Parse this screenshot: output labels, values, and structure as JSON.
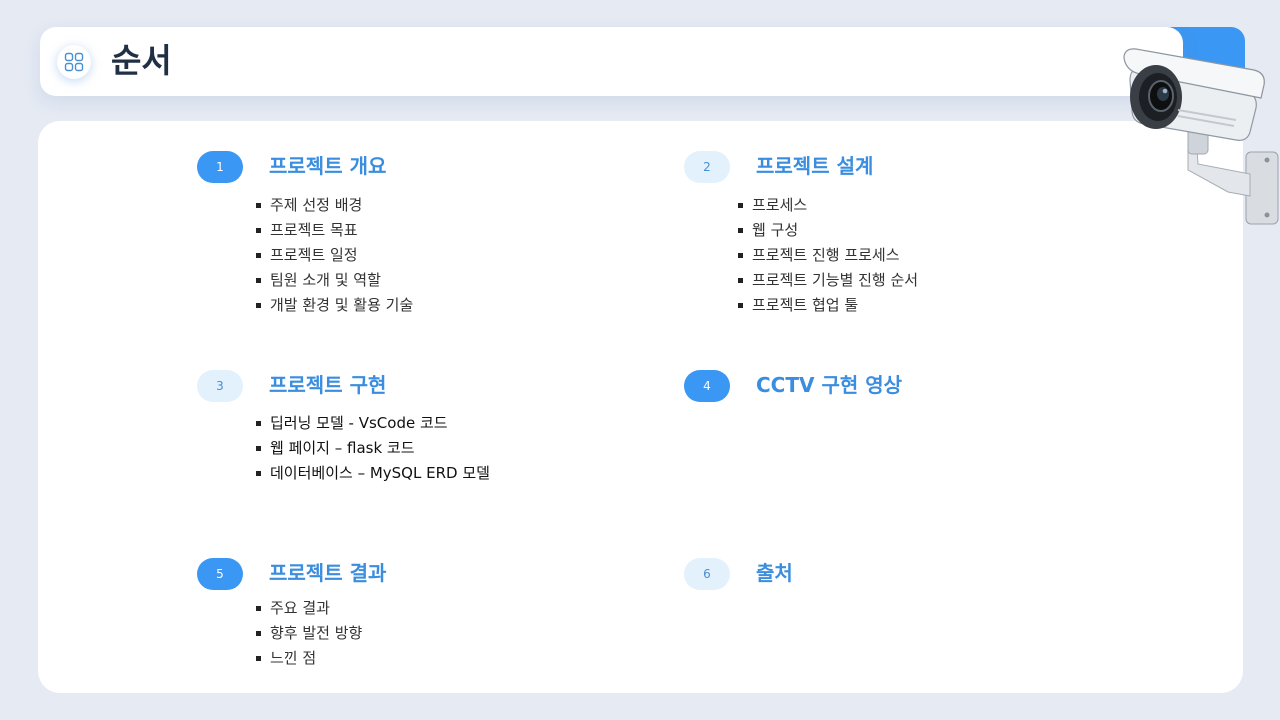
{
  "header": {
    "title": "순서"
  },
  "sections": [
    {
      "number": "1",
      "title": "프로젝트 개요",
      "items": [
        "주제 선정 배경",
        "프로젝트 목표",
        "프로젝트 일정",
        "팀원 소개 및 역할",
        "개발 환경 및 활용 기술"
      ]
    },
    {
      "number": "2",
      "title": "프로젝트 설계",
      "items": [
        "프로세스",
        "웹 구성",
        "프로젝트 진행 프로세스",
        "프로젝트 기능별 진행 순서",
        "프로젝트 협업 툴"
      ]
    },
    {
      "number": "3",
      "title": "프로젝트 구현",
      "items": [
        "딥러닝 모델 - VsCode 코드",
        "웹 페이지 – flask 코드",
        "데이터베이스 – MySQL ERD 모델"
      ]
    },
    {
      "number": "4",
      "title": "CCTV 구현 영상",
      "items": []
    },
    {
      "number": "5",
      "title": "프로젝트 결과",
      "items": [
        "주요 결과",
        "향후 발전 방향",
        "느낀 점"
      ]
    },
    {
      "number": "6",
      "title": "출처",
      "items": []
    }
  ],
  "colors": {
    "accent": "#3a97f3",
    "badge_light": "#e3f1fd",
    "title_blue": "#3a8ddf",
    "background": "#e5eaf3"
  },
  "icons": {
    "header": "grid-icon",
    "decoration": "cctv-camera-icon"
  }
}
